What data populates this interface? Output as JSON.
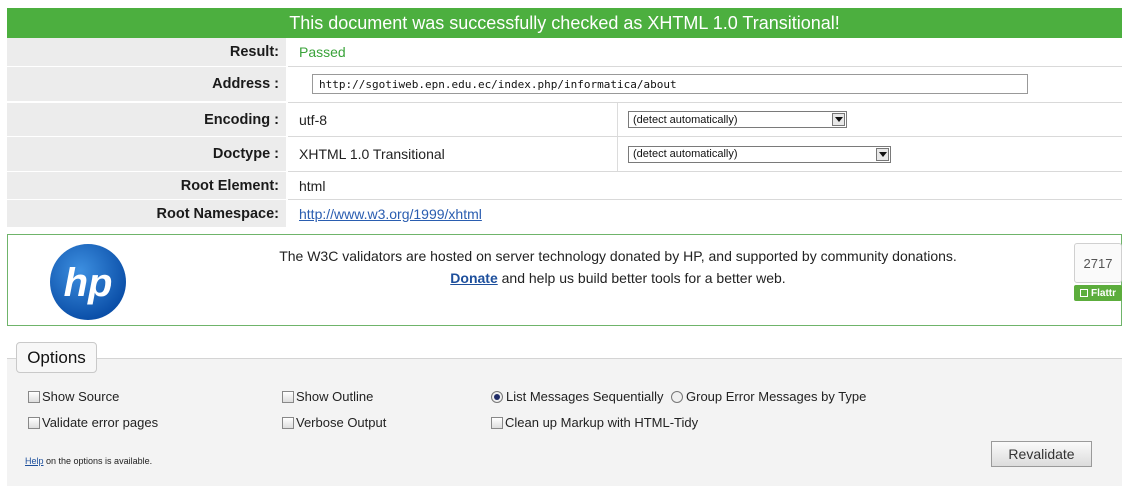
{
  "banner": {
    "text": "This document was successfully checked as XHTML 1.0 Transitional!"
  },
  "result": {
    "result_label": "Result:",
    "result_value": "Passed",
    "address_label": "Address :",
    "address_value": "http://sgotiweb.epn.edu.ec/index.php/informatica/about",
    "encoding_label": "Encoding :",
    "encoding_value": "utf-8",
    "encoding_select": "(detect automatically)",
    "doctype_label": "Doctype :",
    "doctype_value": "XHTML 1.0 Transitional",
    "doctype_select": "(detect automatically)",
    "root_element_label": "Root Element:",
    "root_element_value": "html",
    "root_namespace_label": "Root Namespace:",
    "root_namespace_value": "http://www.w3.org/1999/xhtml"
  },
  "sponsor": {
    "line1": "The W3C validators are hosted on server technology donated by HP, and supported by community donations.",
    "donate_link": "Donate",
    "line2_rest": " and help us build better tools for a better web.",
    "flattr_count": "2717",
    "flattr_label": "Flattr",
    "logo_text": "hp"
  },
  "options": {
    "legend": "Options",
    "show_source": "Show Source",
    "show_outline": "Show Outline",
    "list_sequentially": "List Messages Sequentially",
    "group_by_type": "Group Error Messages by Type",
    "validate_error_pages": "Validate error pages",
    "verbose_output": "Verbose Output",
    "clean_up": "Clean up Markup with HTML-Tidy",
    "help_link": "Help",
    "help_rest": " on the options is available.",
    "revalidate": "Revalidate"
  }
}
